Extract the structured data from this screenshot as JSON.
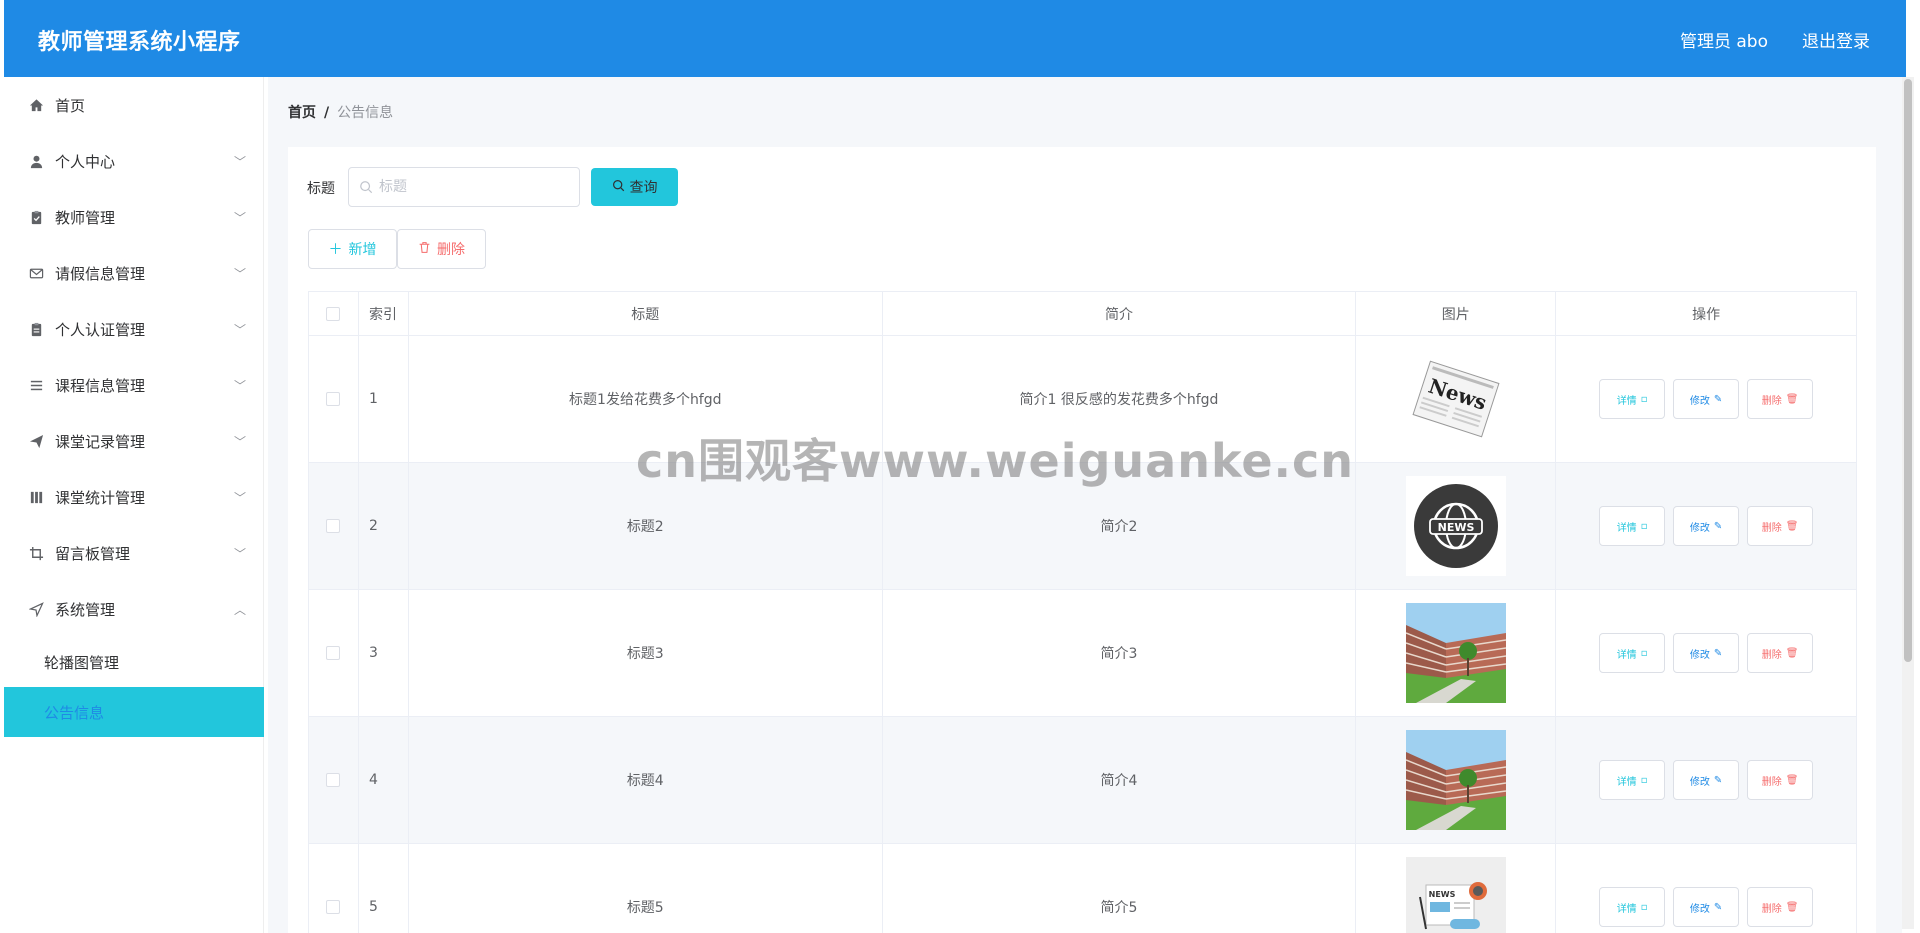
{
  "header": {
    "title": "教师管理系统小程序",
    "user": "管理员 abo",
    "logout": "退出登录"
  },
  "sidebar": {
    "items": [
      {
        "label": "首页",
        "icon": "home-icon",
        "expandable": false
      },
      {
        "label": "个人中心",
        "icon": "user-icon",
        "expandable": true
      },
      {
        "label": "教师管理",
        "icon": "clipboard-icon",
        "expandable": true
      },
      {
        "label": "请假信息管理",
        "icon": "mail-icon",
        "expandable": true
      },
      {
        "label": "个人认证管理",
        "icon": "id-card-icon",
        "expandable": true
      },
      {
        "label": "课程信息管理",
        "icon": "list-icon",
        "expandable": true
      },
      {
        "label": "课堂记录管理",
        "icon": "send-icon",
        "expandable": true
      },
      {
        "label": "课堂统计管理",
        "icon": "chart-icon",
        "expandable": true
      },
      {
        "label": "留言板管理",
        "icon": "crop-icon",
        "expandable": true
      },
      {
        "label": "系统管理",
        "icon": "navigation-icon",
        "expandable": true,
        "expanded": true
      }
    ],
    "sub_items": [
      {
        "label": "轮播图管理",
        "active": false
      },
      {
        "label": "公告信息",
        "active": true
      }
    ],
    "colors": {
      "active_bg": "#22c6dc",
      "active_text": "#1f8ae5"
    }
  },
  "breadcrumb": {
    "home": "首页",
    "separator": "/",
    "current": "公告信息"
  },
  "search": {
    "label": "标题",
    "placeholder": "标题",
    "value": "",
    "button": "查询"
  },
  "actions": {
    "add": "新增",
    "delete": "删除"
  },
  "table": {
    "headers": {
      "index": "索引",
      "title": "标题",
      "intro": "简介",
      "image": "图片",
      "ops": "操作"
    },
    "rows": [
      {
        "index": "1",
        "title": "标题1发给花费多个hfgd",
        "intro": "简介1 很反感的发花费多个hfgd",
        "image": "newspaper"
      },
      {
        "index": "2",
        "title": "标题2",
        "intro": "简介2",
        "image": "news-globe"
      },
      {
        "index": "3",
        "title": "标题3",
        "intro": "简介3",
        "image": "campus-building"
      },
      {
        "index": "4",
        "title": "标题4",
        "intro": "简介4",
        "image": "campus-building"
      },
      {
        "index": "5",
        "title": "标题5",
        "intro": "简介5",
        "image": "news-illustration"
      }
    ],
    "ops": {
      "detail": "详情",
      "edit": "修改",
      "delete": "删除"
    }
  },
  "image_text": {
    "newspaper": "News",
    "globe": "NEWS",
    "illustration": "NEWS"
  },
  "watermark": "cn围观客www.weiguanke.cn",
  "colors": {
    "header": "#1f8ae5",
    "primary": "#22c6dc",
    "danger": "#f56c6c"
  }
}
